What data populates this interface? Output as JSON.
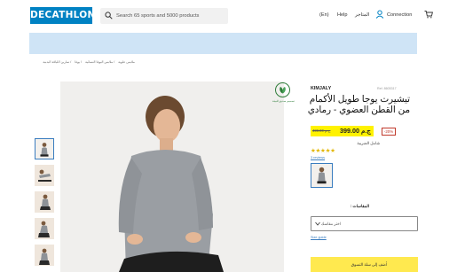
{
  "header": {
    "logo": "DECATHLON",
    "search_placeholder": "Search 65 sports and 5000 products",
    "lang": "(En)",
    "help": "Help",
    "stores": "المتاجر",
    "connection": "Connection",
    "icons": {
      "search": "search-icon",
      "user": "user-icon",
      "cart": "cart-icon"
    },
    "brand_color": "#0082c3"
  },
  "banner": {
    "color": "#cfe4f6"
  },
  "breadcrumb": {
    "items": [
      "ملابس علوية",
      "ملابس اليوغا النسائية",
      "يوغا",
      "تمارين اللياقة البدنية"
    ]
  },
  "gallery": {
    "thumbnail_count": 6,
    "active_index": 0
  },
  "product": {
    "eco_label": "تصميم صديق للبيئة",
    "brand": "KIMJALY",
    "ref": "Ref. 8605317",
    "title": "تيشيرت يوجا طويل الأكمام من القطن العضوي - رمادي",
    "price": {
      "old": "ج.م 499.00",
      "current": "ج.م 399.00",
      "discount": "-20%",
      "highlight_color": "#fff200"
    },
    "tax_note": "شامل الضريبة",
    "rating": {
      "stars": "★★★★★",
      "reviews": "3 reviews"
    },
    "sizes": {
      "label": "المقاسات :",
      "placeholder": "اختر مقاسك",
      "guide": "Size guide"
    },
    "add_to_cart": "أضف إلى سلة التسوق",
    "cta_color": "#ffe94f"
  }
}
